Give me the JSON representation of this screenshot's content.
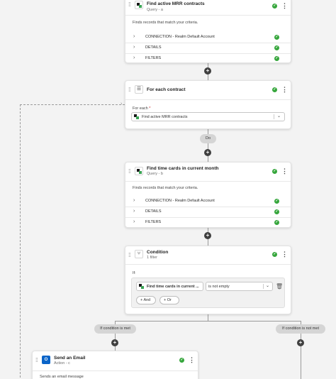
{
  "card1": {
    "title": "Find active MRR contracts",
    "subtitle": "Query - a",
    "desc": "Finds records that match your criteria.",
    "rows": [
      {
        "label": "CONNECTION - Realm Default Account"
      },
      {
        "label": "DETAILS"
      },
      {
        "label": "FILTERS"
      }
    ]
  },
  "card2": {
    "title": "For each contract",
    "foreach_label": "For each",
    "required_mark": "*",
    "selected": "Find active MRR contracts"
  },
  "do_label": "Do",
  "card3": {
    "title": "Find time cards in current month",
    "subtitle": "Query - b",
    "desc": "Finds records that match your criteria.",
    "rows": [
      {
        "label": "CONNECTION - Realm Default Account"
      },
      {
        "label": "DETAILS"
      },
      {
        "label": "FILTERS"
      }
    ]
  },
  "card4": {
    "title": "Condition",
    "subtitle": "1 filter",
    "if_label": "If:",
    "field_value": "Find time cards in current ...",
    "operator_value": "is not empty",
    "and_label": "And",
    "or_label": "Or"
  },
  "branch_true": "If condition is met",
  "branch_false": "If condition is not met",
  "card5": {
    "title": "Send an Email",
    "subtitle": "Action - c",
    "desc": "Sends an email message"
  },
  "colors": {
    "success": "#36a63c",
    "connector": "#3f3f3f",
    "pill": "#d5d5d5",
    "outlook": "#0a64c8"
  }
}
